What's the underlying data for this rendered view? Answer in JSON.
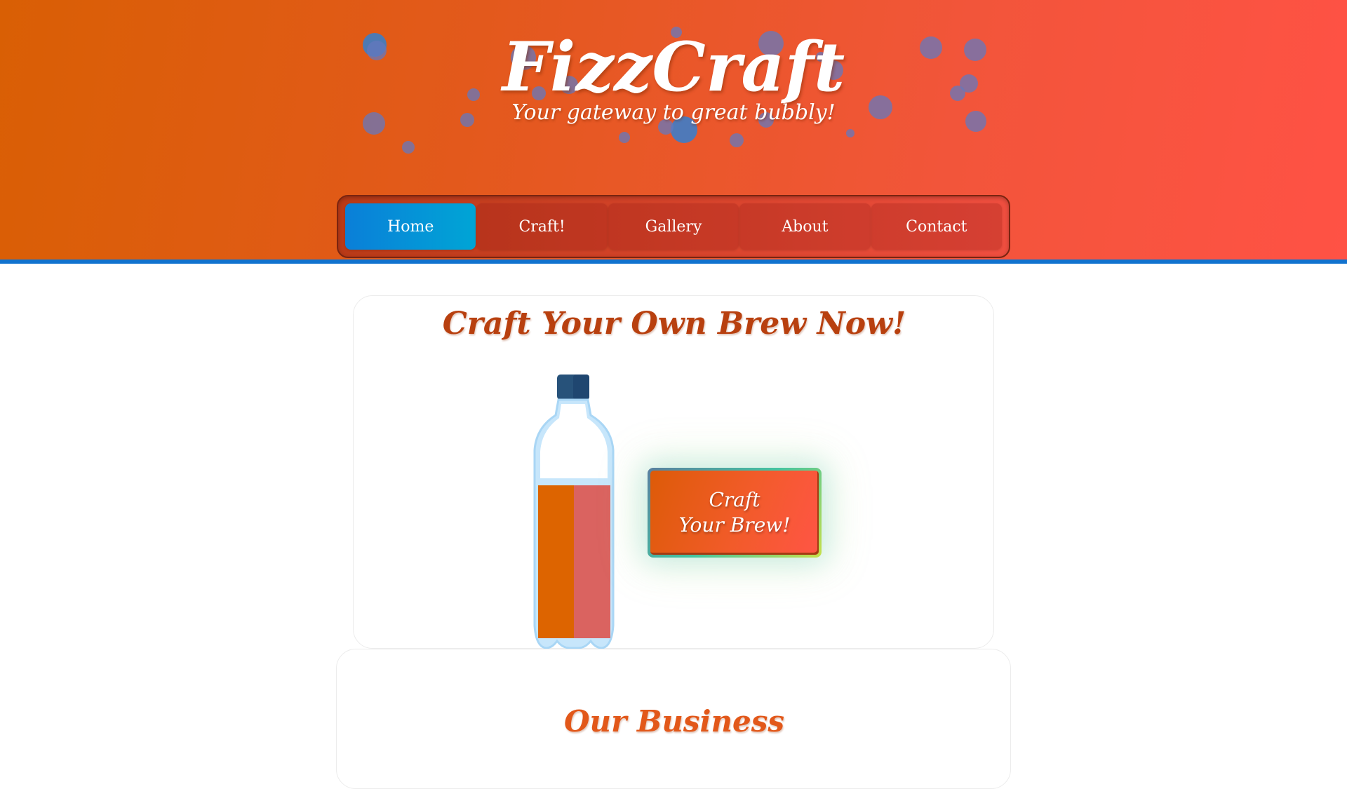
{
  "brand": {
    "title": "FizzCraft",
    "tagline": "Your gateway to great bubbly!"
  },
  "nav": {
    "items": [
      {
        "label": "Home",
        "active": true
      },
      {
        "label": "Craft!",
        "active": false
      },
      {
        "label": "Gallery",
        "active": false
      },
      {
        "label": "About",
        "active": false
      },
      {
        "label": "Contact",
        "active": false
      }
    ]
  },
  "hero": {
    "heading": "Craft Your Own Brew Now!",
    "button_line1": "Craft",
    "button_line2": "Your Brew!",
    "bottle_fill_fraction": 0.78,
    "bottle_colors": [
      "#dd6400",
      "#da6360"
    ]
  },
  "business": {
    "heading": "Our Business"
  },
  "colors": {
    "header_start": "#d95f04",
    "header_end": "#ff5245",
    "nav_active": "#0a7fd8",
    "header_border": "#1173cf",
    "heading": "#b8400f"
  }
}
